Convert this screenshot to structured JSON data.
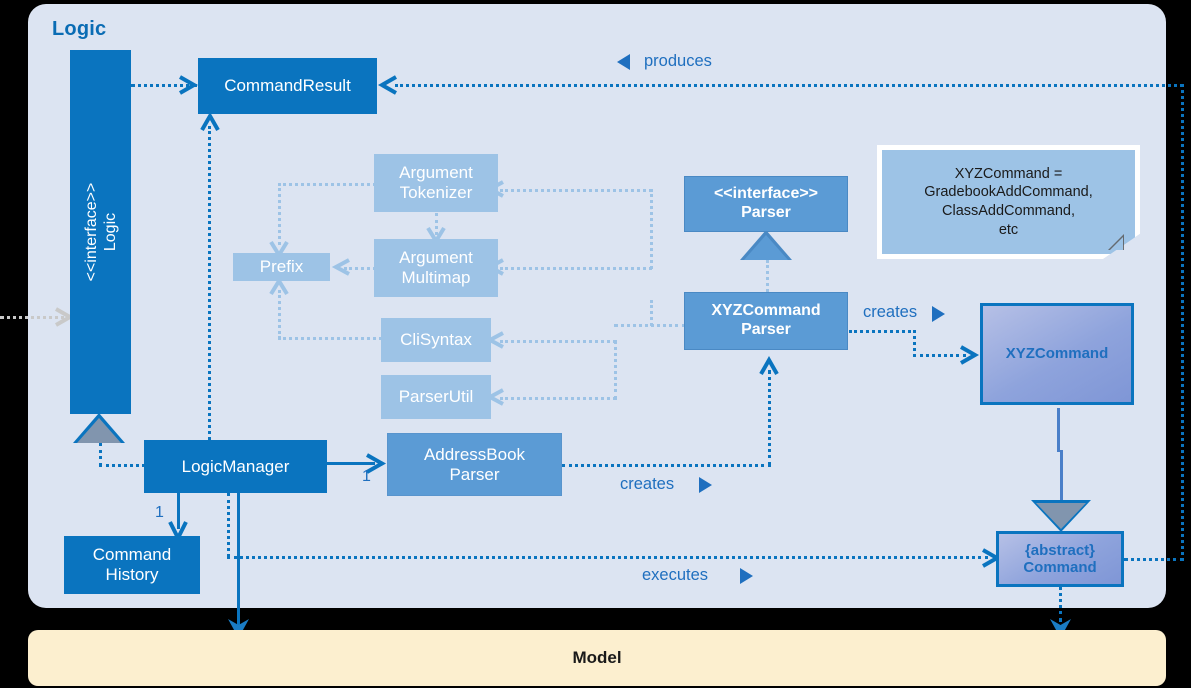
{
  "diagram": {
    "logic_panel_title": "Logic",
    "model_panel_title": "Model"
  },
  "nodes": {
    "logic_interface": {
      "stereotype": "<<interface>>",
      "name": "Logic"
    },
    "command_result": {
      "name": "CommandResult"
    },
    "argument_tokenizer": {
      "line1": "Argument",
      "line2": "Tokenizer"
    },
    "argument_multimap": {
      "line1": "Argument",
      "line2": "Multimap"
    },
    "prefix": {
      "name": "Prefix"
    },
    "cli_syntax": {
      "name": "CliSyntax"
    },
    "parser_util": {
      "name": "ParserUtil"
    },
    "parser_interface": {
      "stereotype": "<<interface>>",
      "name": "Parser"
    },
    "xyz_command_parser": {
      "line1": "XYZCommand",
      "line2": "Parser"
    },
    "xyz_command": {
      "name": "XYZCommand"
    },
    "abstract_command": {
      "line1": "{abstract}",
      "line2": "Command"
    },
    "logic_manager": {
      "name": "LogicManager"
    },
    "command_history": {
      "line1": "Command",
      "line2": "History"
    },
    "addressbook_parser": {
      "line1": "AddressBook",
      "line2": "Parser"
    },
    "note": {
      "line1": "XYZCommand =",
      "line2": "GradebookAddCommand,",
      "line3": "ClassAddCommand,",
      "line4": "etc"
    }
  },
  "edges": {
    "produces_label": "produces",
    "creates_parser_label": "creates",
    "creates_command_label": "creates",
    "executes_label": "executes",
    "multiplicity_addressbook": "1",
    "multiplicity_history": "1"
  },
  "colors": {
    "panel_bg": "#DCE4F2",
    "model_bg": "#FCEFCF",
    "dark_blue": "#0A74BF",
    "mid_blue": "#5B9BD5",
    "light_blue": "#9DC3E6",
    "gradient_command": "#8EA3DC",
    "text_blue": "#1F6FBF",
    "inherit_gray": "#8195AE"
  }
}
